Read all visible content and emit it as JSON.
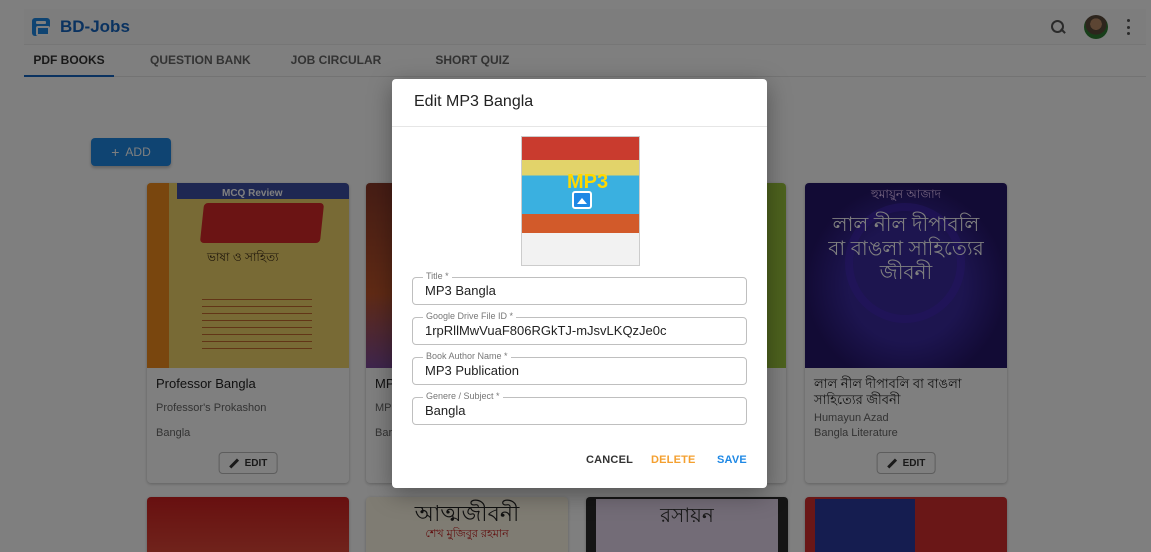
{
  "appbar": {
    "title": "BD-Jobs"
  },
  "tabs": [
    {
      "label": "PDF BOOKS"
    },
    {
      "label": "QUESTION BANK"
    },
    {
      "label": "JOB CIRCULAR"
    },
    {
      "label": "SHORT QUIZ"
    }
  ],
  "add_button": {
    "label": "ADD"
  },
  "cards": [
    {
      "cover_heading": "MCQ Review",
      "cover_sub": "ভাষা ও সাহিত্য",
      "title": "Professor Bangla",
      "author": "Professor's Prokashon",
      "subject": "Bangla",
      "edit_label": "EDIT"
    },
    {
      "cover_top": "হুমায়ুন আজাদ",
      "cover_art": "লাল নীল দীপাবলি বা বাঙলা সাহিত্যের জীবনী",
      "title": "লাল নীল দীপাবলি বা বাঙলা সাহিত্যের জীবনী",
      "author": "Humayun Azad",
      "subject": "Bangla Literature",
      "edit_label": "EDIT"
    }
  ],
  "partial_cards": [
    {
      "title": "MP",
      "author": "MP",
      "subject": "Bar"
    }
  ],
  "bottom_covers": [
    {
      "title": "আত্মজীবনী",
      "sub": "শেখ মুজিবুর রহমান"
    },
    {
      "title": "রসায়ন"
    }
  ],
  "dialog": {
    "title": "Edit MP3 Bangla",
    "thumb_text": "MP3",
    "fields": [
      {
        "label": "Title *",
        "value": "MP3 Bangla"
      },
      {
        "label": "Google Drive File ID *",
        "value": "1rpRllMwVuaF806RGkTJ-mJsvLKQzJe0c"
      },
      {
        "label": "Book Author Name *",
        "value": "MP3 Publication"
      },
      {
        "label": "Genere / Subject *",
        "value": "Bangla"
      }
    ],
    "actions": {
      "cancel": "CANCEL",
      "delete": "DELETE",
      "save": "SAVE"
    }
  },
  "colors": {
    "primary": "#1e88e5",
    "delete": "#f4a030",
    "overlay": "rgba(0,0,0,0.5)"
  },
  "icons": [
    "app-logo-icon",
    "search-icon",
    "more-vert-icon",
    "plus-icon",
    "pencil-icon",
    "image-icon"
  ]
}
